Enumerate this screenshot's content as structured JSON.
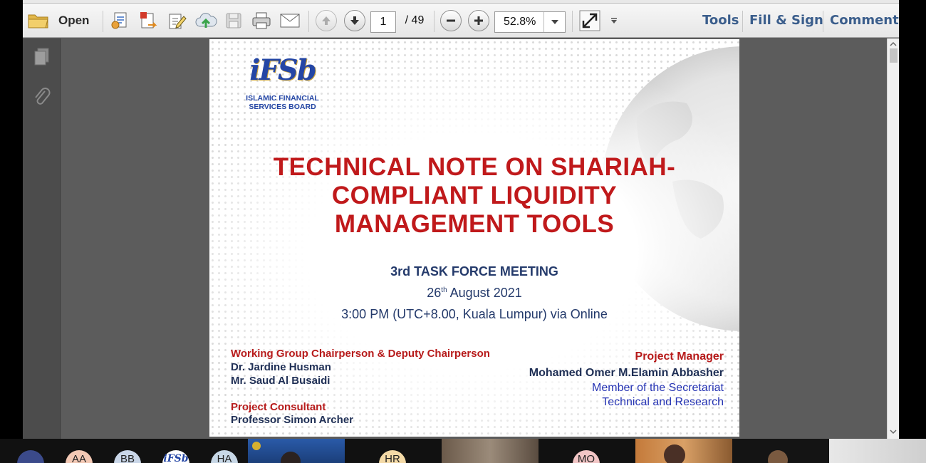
{
  "toolbar": {
    "open_label": "Open",
    "page_current": "1",
    "page_total": "/ 49",
    "zoom_value": "52.8%",
    "tools_label": "Tools",
    "fill_sign_label": "Fill & Sign",
    "comment_label": "Comment"
  },
  "slide": {
    "logo_text": "iFSb",
    "org_line1": "ISLAMIC FINANCIAL",
    "org_line2": "SERVICES BOARD",
    "title_line1": "TECHNICAL NOTE ON SHARIAH-",
    "title_line2": "COMPLIANT LIQUIDITY",
    "title_line3": "MANAGEMENT TOOLS",
    "meeting": "3rd  TASK FORCE MEETING",
    "date_day": "26",
    "date_suffix": "th",
    "date_rest": " August 2021",
    "time": "3:00 PM (UTC+8.00, Kuala Lumpur) via Online",
    "wg_heading": "Working Group Chairperson & Deputy Chairperson",
    "wg_name1": "Dr. Jardine Husman",
    "wg_name2": "Mr. Saud Al Busaidi",
    "consultant_heading": "Project Consultant",
    "consultant_name": "Professor Simon Archer",
    "pm_heading": "Project Manager",
    "pm_name": "Mohamed Omer M.Elamin Abbasher",
    "pm_role1": "Member of the Secretariat",
    "pm_role2": "Technical and Research"
  },
  "participants": [
    {
      "initials": "",
      "color": "#3b4a8a"
    },
    {
      "initials": "AA",
      "color": "#f3c9b5"
    },
    {
      "initials": "BB",
      "color": "#c9d6e8"
    },
    {
      "initials": "",
      "color": "#ffffff"
    },
    {
      "initials": "HA",
      "color": "#c7d7e6"
    },
    {
      "initials": "HR",
      "color": "#f3d9a6"
    },
    {
      "initials": "MO",
      "color": "#f2c5c5"
    }
  ],
  "colors": {
    "title_red": "#c0191b",
    "navy": "#243a6b",
    "link_blue": "#2533b3",
    "toolbar_link": "#3b5e8c"
  }
}
